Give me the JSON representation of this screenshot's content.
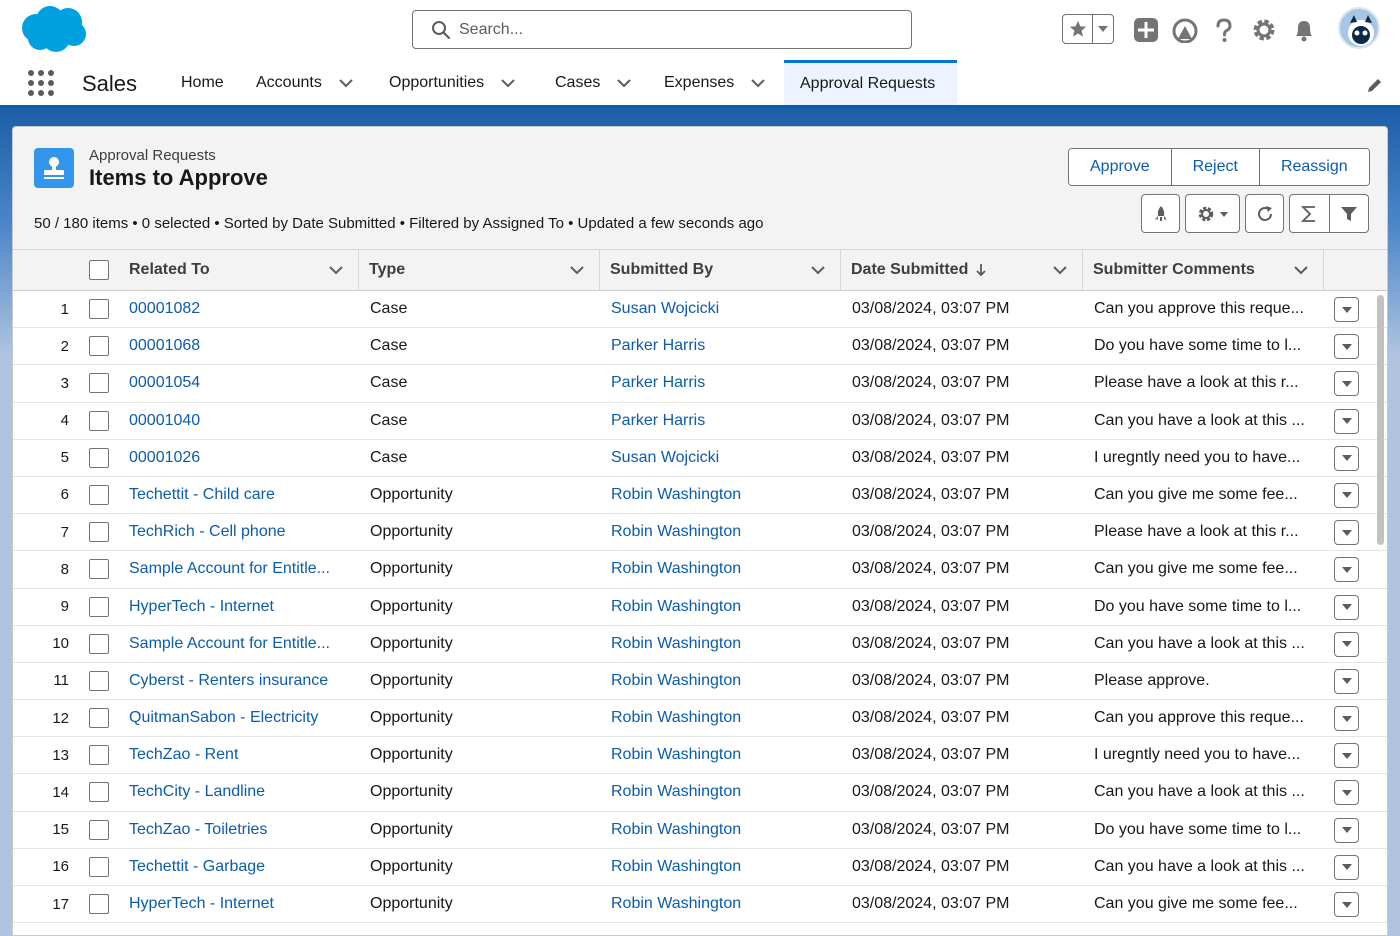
{
  "header": {
    "search_placeholder": "Search..."
  },
  "nav": {
    "app_name": "Sales",
    "items": [
      {
        "label": "Home"
      },
      {
        "label": "Accounts"
      },
      {
        "label": "Opportunities"
      },
      {
        "label": "Cases"
      },
      {
        "label": "Expenses"
      },
      {
        "label": "Approval Requests"
      }
    ]
  },
  "list": {
    "object_label": "Approval Requests",
    "title": "Items to Approve",
    "status": "50 / 180 items • 0 selected • Sorted by Date Submitted • Filtered by Assigned To • Updated a few seconds ago",
    "actions": {
      "approve": "Approve",
      "reject": "Reject",
      "reassign": "Reassign"
    }
  },
  "table": {
    "columns": [
      "Related To",
      "Type",
      "Submitted By",
      "Date Submitted",
      "Submitter Comments"
    ],
    "rows": [
      {
        "n": "1",
        "related": "00001082",
        "type": "Case",
        "by": "Susan Wojcicki",
        "date": "03/08/2024, 03:07 PM",
        "comment": "Can you approve this reque..."
      },
      {
        "n": "2",
        "related": "00001068",
        "type": "Case",
        "by": "Parker Harris",
        "date": "03/08/2024, 03:07 PM",
        "comment": "Do you have some time to l..."
      },
      {
        "n": "3",
        "related": "00001054",
        "type": "Case",
        "by": "Parker Harris",
        "date": "03/08/2024, 03:07 PM",
        "comment": "Please have a look at this r..."
      },
      {
        "n": "4",
        "related": "00001040",
        "type": "Case",
        "by": "Parker Harris",
        "date": "03/08/2024, 03:07 PM",
        "comment": "Can you have a look at this ..."
      },
      {
        "n": "5",
        "related": "00001026",
        "type": "Case",
        "by": "Susan Wojcicki",
        "date": "03/08/2024, 03:07 PM",
        "comment": "I uregntly need you to have..."
      },
      {
        "n": "6",
        "related": "Techettit - Child care",
        "type": "Opportunity",
        "by": "Robin Washington",
        "date": "03/08/2024, 03:07 PM",
        "comment": "Can you give me some fee..."
      },
      {
        "n": "7",
        "related": "TechRich - Cell phone",
        "type": "Opportunity",
        "by": "Robin Washington",
        "date": "03/08/2024, 03:07 PM",
        "comment": "Please have a look at this r..."
      },
      {
        "n": "8",
        "related": "Sample Account for Entitle...",
        "type": "Opportunity",
        "by": "Robin Washington",
        "date": "03/08/2024, 03:07 PM",
        "comment": "Can you give me some fee..."
      },
      {
        "n": "9",
        "related": "HyperTech - Internet",
        "type": "Opportunity",
        "by": "Robin Washington",
        "date": "03/08/2024, 03:07 PM",
        "comment": "Do you have some time to l..."
      },
      {
        "n": "10",
        "related": "Sample Account for Entitle...",
        "type": "Opportunity",
        "by": "Robin Washington",
        "date": "03/08/2024, 03:07 PM",
        "comment": "Can you have a look at this ..."
      },
      {
        "n": "11",
        "related": "Cyberst - Renters insurance",
        "type": "Opportunity",
        "by": "Robin Washington",
        "date": "03/08/2024, 03:07 PM",
        "comment": "Please approve."
      },
      {
        "n": "12",
        "related": "QuitmanSabon - Electricity",
        "type": "Opportunity",
        "by": "Robin Washington",
        "date": "03/08/2024, 03:07 PM",
        "comment": "Can you approve this reque..."
      },
      {
        "n": "13",
        "related": "TechZao - Rent",
        "type": "Opportunity",
        "by": "Robin Washington",
        "date": "03/08/2024, 03:07 PM",
        "comment": "I uregntly need you to have..."
      },
      {
        "n": "14",
        "related": "TechCity - Landline",
        "type": "Opportunity",
        "by": "Robin Washington",
        "date": "03/08/2024, 03:07 PM",
        "comment": "Can you have a look at this ..."
      },
      {
        "n": "15",
        "related": "TechZao - Toiletries",
        "type": "Opportunity",
        "by": "Robin Washington",
        "date": "03/08/2024, 03:07 PM",
        "comment": "Do you have some time to l..."
      },
      {
        "n": "16",
        "related": "Techettit - Garbage",
        "type": "Opportunity",
        "by": "Robin Washington",
        "date": "03/08/2024, 03:07 PM",
        "comment": "Can you have a look at this ..."
      },
      {
        "n": "17",
        "related": "HyperTech - Internet",
        "type": "Opportunity",
        "by": "Robin Washington",
        "date": "03/08/2024, 03:07 PM",
        "comment": "Can you give me some fee..."
      }
    ]
  },
  "colors": {
    "brand": "#0176d3",
    "link": "#0b5cab",
    "band": "#1b5ea8"
  }
}
